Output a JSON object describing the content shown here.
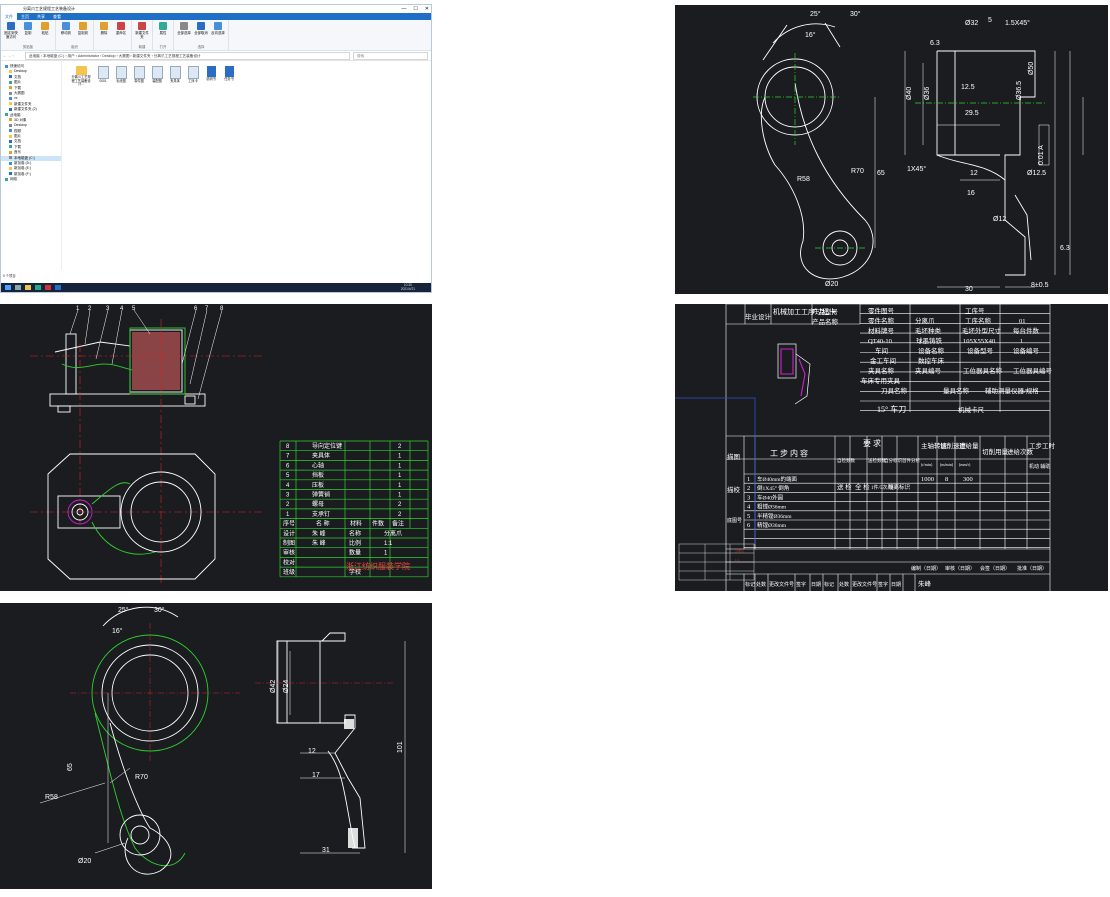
{
  "explorer": {
    "title": "分离爪工艺规程工艺装备设计",
    "controls": [
      "—",
      "☐",
      "✕"
    ],
    "menu": [
      "文件",
      "主页",
      "共享",
      "查看"
    ],
    "ribbon_groups": [
      {
        "label": "剪贴板",
        "buttons": [
          "固定到快速访问",
          "复制",
          "粘贴"
        ]
      },
      {
        "label": "组织",
        "buttons": [
          "移动到",
          "复制到"
        ]
      },
      {
        "label": "",
        "buttons": [
          "删除",
          "重命名"
        ]
      },
      {
        "label": "新建",
        "buttons": [
          "新建文件夹"
        ]
      },
      {
        "label": "打开",
        "buttons": [
          "属性"
        ]
      },
      {
        "label": "选择",
        "buttons": [
          "全部选择",
          "全部取消",
          "反向选择"
        ]
      }
    ],
    "address_path": "此电脑 › 本地磁盘 (C:) › 用户 › Administrator › Desktop › 大赛图 › 新建文件夹 › 分离爪工艺规程工艺装备设计",
    "search_placeholder": "搜索",
    "nav_items": [
      {
        "label": "快速访问",
        "level": 0
      },
      {
        "label": "Desktop",
        "level": 1
      },
      {
        "label": "文档",
        "level": 1
      },
      {
        "label": "图片",
        "level": 1
      },
      {
        "label": "下载",
        "level": 1
      },
      {
        "label": "大赛图",
        "level": 1
      },
      {
        "label": "xx",
        "level": 1
      },
      {
        "label": "新建文件夹",
        "level": 1
      },
      {
        "label": "新建文件夹 (2)",
        "level": 1
      },
      {
        "label": "此电脑",
        "level": 0
      },
      {
        "label": "3D 对象",
        "level": 1
      },
      {
        "label": "Desktop",
        "level": 1
      },
      {
        "label": "视频",
        "level": 1
      },
      {
        "label": "图片",
        "level": 1
      },
      {
        "label": "文档",
        "level": 1
      },
      {
        "label": "下载",
        "level": 1
      },
      {
        "label": "音乐",
        "level": 1
      },
      {
        "label": "本地磁盘 (C:)",
        "level": 1,
        "selected": true
      },
      {
        "label": "新加卷 (D:)",
        "level": 1
      },
      {
        "label": "新加卷 (E:)",
        "level": 1
      },
      {
        "label": "新加卷 (F:)",
        "level": 1
      },
      {
        "label": "网络",
        "level": 0
      }
    ],
    "files": [
      {
        "name": "分离爪工艺规程工艺装备设计...",
        "kind": "folder"
      },
      {
        "name": "0001",
        "kind": "dwg"
      },
      {
        "name": "毛坯图",
        "kind": "dwg"
      },
      {
        "name": "零件图",
        "kind": "dwg"
      },
      {
        "name": "装配图",
        "kind": "dwg"
      },
      {
        "name": "夹具体",
        "kind": "dwg"
      },
      {
        "name": "工序卡",
        "kind": "dwg"
      },
      {
        "name": "说明书",
        "kind": "doc"
      },
      {
        "name": "任务书",
        "kind": "doc"
      }
    ],
    "status": "9 个项目",
    "clock": {
      "time": "10:35",
      "date": "2021/4/21"
    }
  },
  "blank_drawing": {
    "dims": [
      "25°",
      "30°",
      "16°",
      "Ø32",
      "5",
      "1.5X45°",
      "6.3",
      "Ø40",
      "Ø36",
      "Ø50",
      "Ø36.5",
      "29.5",
      "12.5",
      "1X45°",
      "R70",
      "R58",
      "65",
      "12",
      "16",
      "Ø12",
      "Ø20",
      "30",
      "8±0.5",
      "0.01 A",
      "6.3",
      "Ø12.5"
    ]
  },
  "assembly": {
    "balloons": [
      "1",
      "2",
      "3",
      "4",
      "5",
      "6",
      "7",
      "8"
    ],
    "bom": [
      {
        "no": "8",
        "name": "导向定位键",
        "qty": "2"
      },
      {
        "no": "7",
        "name": "夹具体",
        "qty": "1"
      },
      {
        "no": "6",
        "name": "心轴",
        "qty": "1"
      },
      {
        "no": "5",
        "name": "挡板",
        "qty": "1"
      },
      {
        "no": "4",
        "name": "压板",
        "qty": "1"
      },
      {
        "no": "3",
        "name": "弹簧销",
        "qty": "1"
      },
      {
        "no": "2",
        "name": "螺母",
        "qty": "2"
      },
      {
        "no": "1",
        "name": "支承钉",
        "qty": "2"
      }
    ],
    "bom_header": [
      "序号",
      "名 称",
      "材料",
      "件数",
      "备注"
    ],
    "title_block": {
      "rows": [
        [
          "设计",
          "朱 峰"
        ],
        [
          "制图",
          "朱 峰"
        ],
        [
          "审核",
          ""
        ],
        [
          "校对",
          ""
        ],
        [
          "班级",
          ""
        ]
      ],
      "mid": [
        "名称",
        "比例",
        "数量",
        "",
        "学校"
      ],
      "vals": [
        "分离爪",
        "1:1",
        "1",
        "",
        ""
      ],
      "school": "浙江纺织服装学院"
    }
  },
  "card": {
    "h_left": "毕业设计",
    "h_title": "机械加工工序过程卡",
    "h_prod_type": "产品型号",
    "h_prod_name": "产品名称",
    "h_part_no": "零件图号",
    "h_part_name": "零件名称",
    "part_name_val": "分离爪",
    "h_op_no": "工序号",
    "h_op_name": "工序名称",
    "op_name_val": "01",
    "h_material": "材料牌号",
    "material_val": "QT40-10",
    "h_blank_type": "毛坯种类",
    "blank_type_val": "球墨铸铁",
    "h_blank_size": "毛坯外型尺寸",
    "blank_size_val": "105X55X40",
    "h_per_blank": "每台件数",
    "per_blank_val": "1",
    "h_workshop": "车间",
    "workshop_val": "金工车间",
    "h_equip_name": "设备名称",
    "equip_name_val": "数控车床",
    "h_equip_model": "设备型号",
    "h_equip_no": "设备编号",
    "h_fixture_name": "夹具名称",
    "fixture_name_val": "车床专用夹具",
    "h_fixture_no": "夹具编号",
    "h_station_name": "工位器具名称",
    "h_station_no": "工位器具编号",
    "h_tool": "刀具名称",
    "tool_val": "15° 车刀",
    "h_gauge": "量具名称",
    "gauge_val": "机械卡尺",
    "h_aux": "辅助测量仪器/规格",
    "h_draw": "描图",
    "h_check": "描校",
    "h_bottom_no": "底图号",
    "h_step": "工 步 内 容",
    "h_req": "要 求",
    "h_self": "自检",
    "h_selfcheck": "自检频数",
    "h_sampling": "送检频数",
    "h_autocheck": "自分标识",
    "h_isolate": "首件分析",
    "h_spindle": "主轴转速",
    "h_spindle_unit": "(r/min)",
    "h_cutspeed": "切削速度",
    "h_cutspeed_unit": "(m/min)",
    "h_feed": "进给量",
    "h_feed_unit": "(mm/r)",
    "h_depth": "切削用量",
    "h_passes": "进给次数",
    "h_time": "工步工时",
    "h_time2": "机动 辅助",
    "steps": [
      {
        "no": "1",
        "text": "车Ø40mm的端面"
      },
      {
        "no": "2",
        "text": "倒1X45° 倒角"
      },
      {
        "no": "3",
        "text": "车Ø40外圆"
      },
      {
        "no": "4",
        "text": "粗镗Ø36mm"
      },
      {
        "no": "5",
        "text": "半精镗Ø36mm"
      },
      {
        "no": "6",
        "text": "精镗Ø36mm"
      }
    ],
    "step1_vals": [
      "1000",
      "8",
      "300"
    ],
    "check_mark": "送 检",
    "full_check": "全 检",
    "freq": "1件/5次/班",
    "iso": "隔离标识",
    "foot_sign": "编制（日期）",
    "foot_review": "审核（日期）",
    "foot_count": "会签（日期）",
    "foot_approve": "批准（日期）",
    "foot_row": [
      "标记",
      "处数",
      "更改文件号",
      "签字",
      "日期",
      "标记",
      "处数",
      "更改文件号",
      "签字",
      "日期"
    ],
    "signer": "朱峰"
  },
  "part_drawing": {
    "dims": [
      "25°",
      "30°",
      "16°",
      "R70",
      "R58",
      "65",
      "Ø20",
      "Ø42",
      "Ø24",
      "12",
      "17",
      "31",
      "101"
    ]
  },
  "colors": {
    "cad_bg": "#1a1c20",
    "line_white": "#ffffff",
    "line_green": "#2fd12f",
    "line_red": "#e02020",
    "line_magenta": "#d020d0",
    "explorer_blue": "#1f6fc6"
  }
}
